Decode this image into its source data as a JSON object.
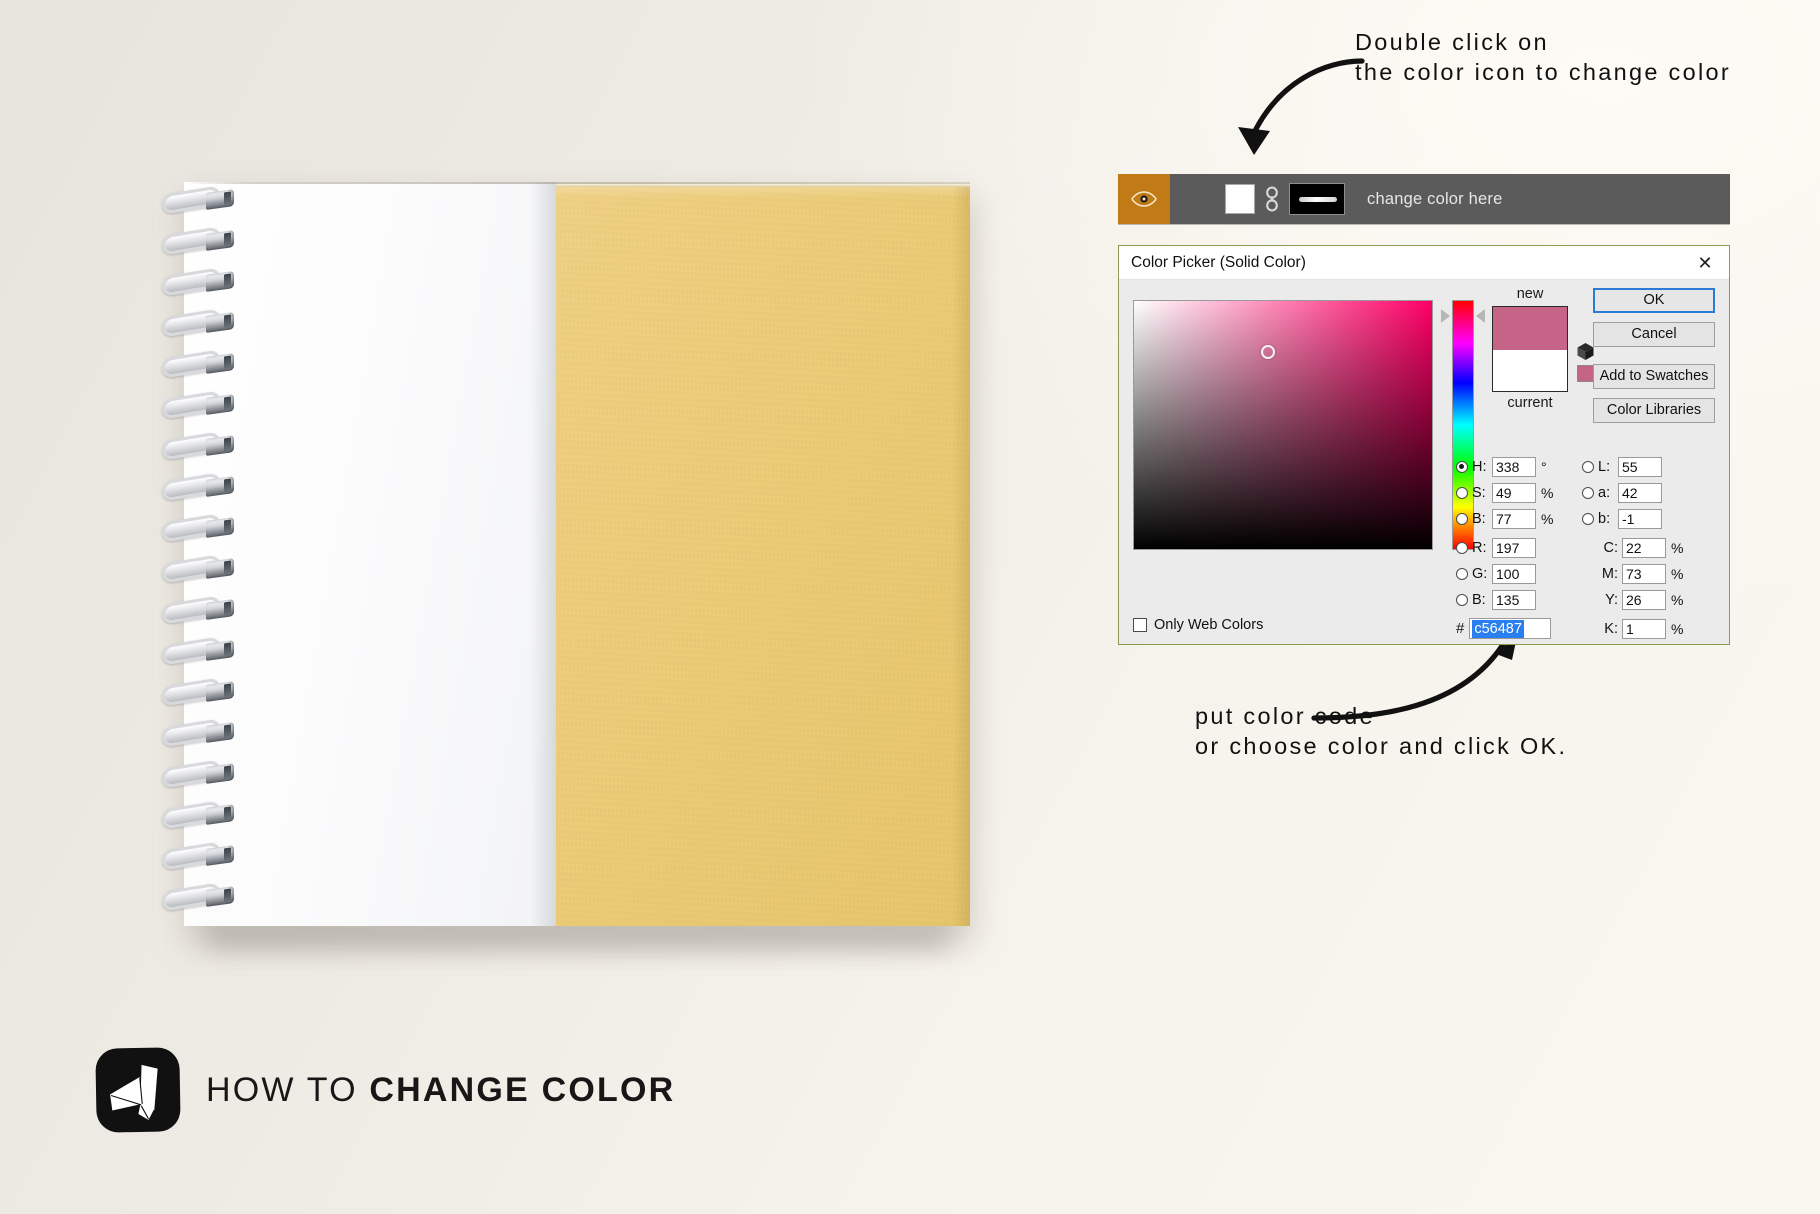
{
  "background": {
    "base_color": "#e7e4dd",
    "highlight_color": "#faf7f0"
  },
  "notebook": {
    "name": "spiral-notebook-mockup",
    "cover_color": "#eccd78",
    "page_color": "#ffffff",
    "binding": "silver-wire-spiral"
  },
  "footer": {
    "logo_icon": "paper-stack-logo-icon",
    "title_thin": "HOW TO",
    "title_bold": "CHANGE COLOR"
  },
  "annotations": {
    "top": {
      "line1": "Double click on",
      "line2": "the color icon to change color",
      "arrow": "curved-arrow-down-left"
    },
    "bottom": {
      "line1": "put color code",
      "line2": "or choose color and click OK.",
      "arrow": "curved-arrow-up-right"
    }
  },
  "layer_row": {
    "eye_icon": "eye-visibility-icon",
    "eye_cell_color": "#c07a16",
    "color_thumbnail_color": "#ffffff",
    "link_icon": "chain-link-icon",
    "mask_thumbnail_color": "#000000",
    "layer_name": "change color here",
    "row_background": "#5b5b5b"
  },
  "color_picker": {
    "title": "Color Picker (Solid Color)",
    "close_icon": "close-icon",
    "buttons": {
      "ok": "OK",
      "cancel": "Cancel",
      "add_to_swatches": "Add to Swatches",
      "color_libraries": "Color Libraries"
    },
    "preview": {
      "new_label": "new",
      "current_label": "current",
      "new_color": "#c56487",
      "current_color": "#ffffff",
      "out_of_gamut_icon": "cube-warning-icon",
      "alt_swatch_color": "#c56487"
    },
    "sv_field": {
      "hue_color": "#ff0066",
      "cursor_x_pct": 45,
      "cursor_y_pct": 20.5
    },
    "hue_slider": {
      "marker_position_pct": 6
    },
    "fields": {
      "hsb": [
        {
          "key": "H:",
          "value": "338",
          "unit": "°",
          "selected": true
        },
        {
          "key": "S:",
          "value": "49",
          "unit": "%",
          "selected": false
        },
        {
          "key": "B:",
          "value": "77",
          "unit": "%",
          "selected": false
        }
      ],
      "lab": [
        {
          "key": "L:",
          "value": "55",
          "unit": "",
          "selected": false
        },
        {
          "key": "a:",
          "value": "42",
          "unit": "",
          "selected": false
        },
        {
          "key": "b:",
          "value": "-1",
          "unit": "",
          "selected": false
        }
      ],
      "rgb": [
        {
          "key": "R:",
          "value": "197",
          "unit": "",
          "selected": false
        },
        {
          "key": "G:",
          "value": "100",
          "unit": "",
          "selected": false
        },
        {
          "key": "B:",
          "value": "135",
          "unit": "",
          "selected": false
        }
      ],
      "cmy": [
        {
          "key": "C:",
          "value": "22",
          "unit": "%"
        },
        {
          "key": "M:",
          "value": "73",
          "unit": "%"
        },
        {
          "key": "Y:",
          "value": "26",
          "unit": "%"
        }
      ],
      "k": {
        "key": "K:",
        "value": "1",
        "unit": "%"
      },
      "hex": {
        "symbol": "#",
        "value": "c56487",
        "selected": true
      }
    },
    "only_web_colors": {
      "label": "Only Web Colors",
      "checked": false
    }
  }
}
